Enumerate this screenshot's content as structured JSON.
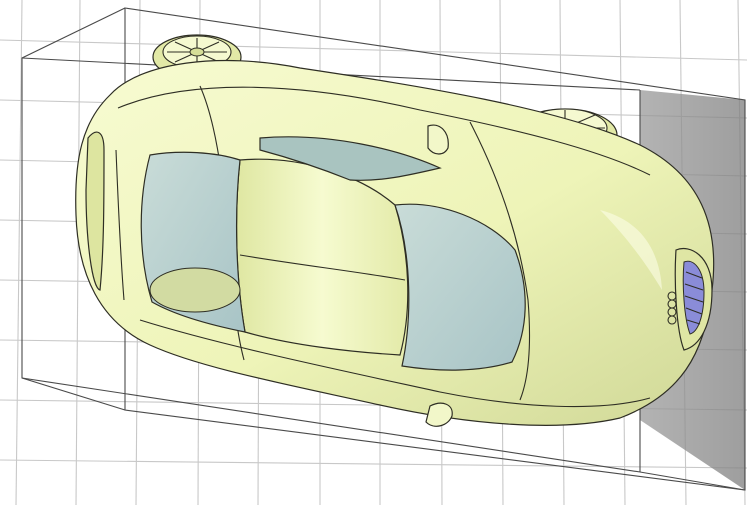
{
  "viewport": {
    "view": "3d-perspective",
    "background_color": "#ffffff",
    "grid_color": "#c8c8c8",
    "bounding_box_edge_color": "#4a4a4a",
    "bounding_box_face_color": "#8c8c8c",
    "model": {
      "body_color": "#eef4b8",
      "body_shadow_color": "#c7cf8a",
      "window_color": "#b8d0d0",
      "outline_color": "#2e2e24",
      "emblem_color": "#8a8cd8"
    },
    "components": [
      "car-body",
      "wheel-front",
      "wheel-rear",
      "mirror-left",
      "mirror-right",
      "windshield",
      "rear-window",
      "side-window",
      "rear-grille",
      "emblem-rings"
    ]
  }
}
